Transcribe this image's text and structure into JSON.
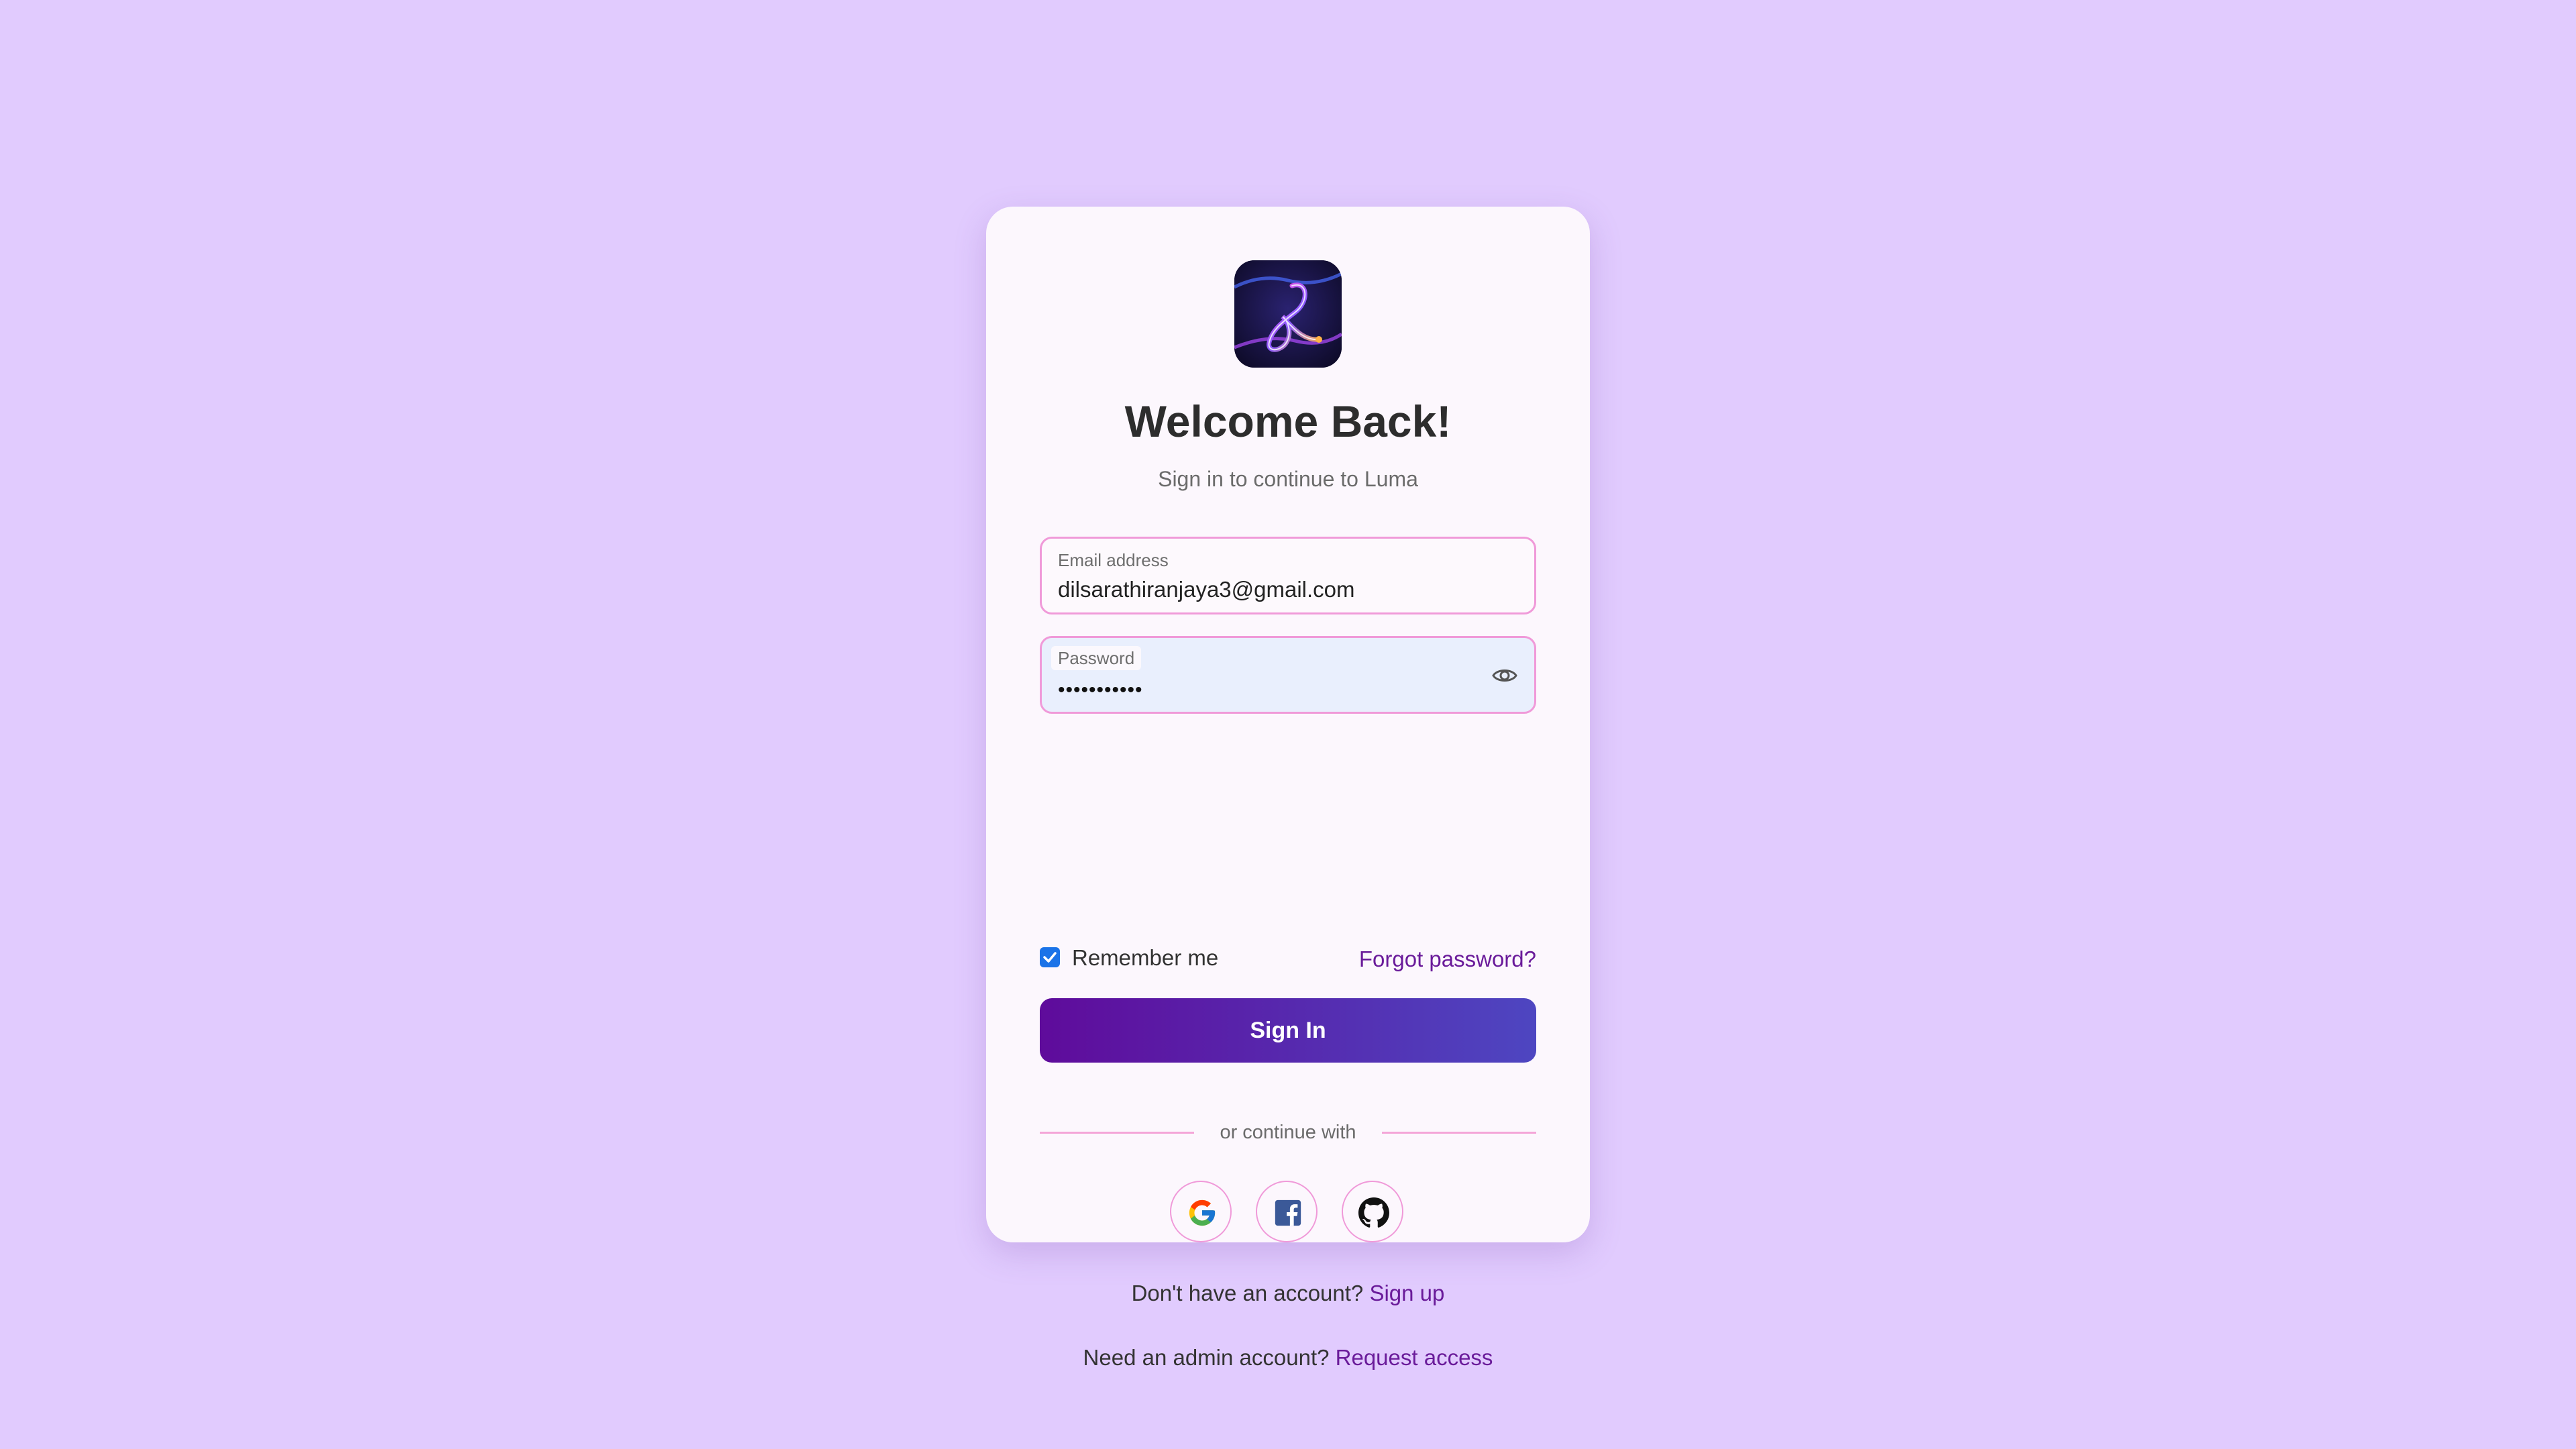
{
  "brand": {
    "app_name": "Luma",
    "logo_icon": "luma-logo-icon"
  },
  "header": {
    "title": "Welcome Back!",
    "subtitle": "Sign in to continue to Luma"
  },
  "form": {
    "email": {
      "label": "Email address",
      "value": "dilsarathiranjaya3@gmail.com"
    },
    "password": {
      "label": "Password",
      "masked_value": "•••••••••••",
      "toggle_icon": "eye-icon"
    },
    "remember_me": {
      "label": "Remember me",
      "checked": true
    },
    "forgot_password_label": "Forgot password?",
    "submit_label": "Sign In"
  },
  "social": {
    "divider_text": "or continue with",
    "providers": [
      {
        "name": "google",
        "icon": "google-icon"
      },
      {
        "name": "facebook",
        "icon": "facebook-icon"
      },
      {
        "name": "github",
        "icon": "github-icon"
      }
    ]
  },
  "footer": {
    "signup_prompt": "Don't have an account?",
    "signup_link": "Sign up",
    "admin_prompt": "Need an admin account?",
    "admin_link": "Request access"
  },
  "colors": {
    "page_background": "#e1cbfe",
    "card_background": "#fcf7fd",
    "accent_border": "#f09ad9",
    "link": "#6a1b9a",
    "button_gradient_start": "#5f0b9b",
    "button_gradient_end": "#4e46c1",
    "checkbox": "#1a73e8"
  }
}
